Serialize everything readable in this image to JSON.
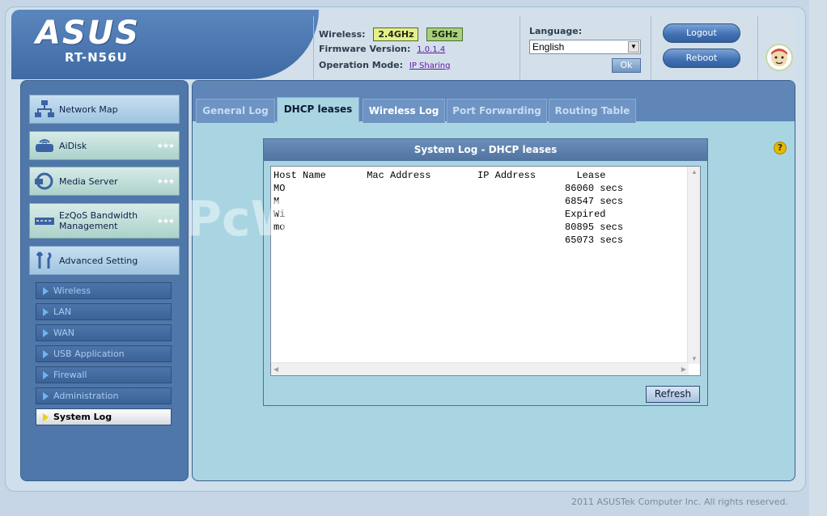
{
  "header": {
    "brand": "ASUS",
    "model": "RT-N56U",
    "wireless_label": "Wireless:",
    "band_24": "2.4GHz",
    "band_5": "5GHz",
    "firmware_label": "Firmware Version:",
    "firmware_value": "1.0.1.4",
    "opmode_label": "Operation Mode:",
    "opmode_value": "IP Sharing",
    "language_label": "Language:",
    "language_value": "English",
    "ok_label": "Ok",
    "logout_label": "Logout",
    "reboot_label": "Reboot"
  },
  "sidebar": {
    "main": [
      {
        "label": "Network Map"
      },
      {
        "label": "AiDisk"
      },
      {
        "label": "Media Server"
      },
      {
        "label": "EzQoS Bandwidth Management"
      },
      {
        "label": "Advanced Setting"
      }
    ],
    "sub": [
      {
        "label": "Wireless"
      },
      {
        "label": "LAN"
      },
      {
        "label": "WAN"
      },
      {
        "label": "USB Application"
      },
      {
        "label": "Firewall"
      },
      {
        "label": "Administration"
      },
      {
        "label": "System Log"
      }
    ]
  },
  "tabs": [
    {
      "label": "General Log"
    },
    {
      "label": "DHCP leases"
    },
    {
      "label": "Wireless Log"
    },
    {
      "label": "Port Forwarding"
    },
    {
      "label": "Routing Table"
    }
  ],
  "panel": {
    "title": "System Log - DHCP leases",
    "log": "Host Name       Mac Address        IP Address       Lease\nMO                                                86060 secs\nM                                                 68547 secs\nWi                                                Expired\nmo                                                80895 secs\n                                                  65073 secs",
    "refresh_label": "Refresh",
    "help_symbol": "?"
  },
  "watermark": "PcWin",
  "footer": {
    "copyright": "2011 ASUSTek Computer Inc. All rights reserved."
  }
}
